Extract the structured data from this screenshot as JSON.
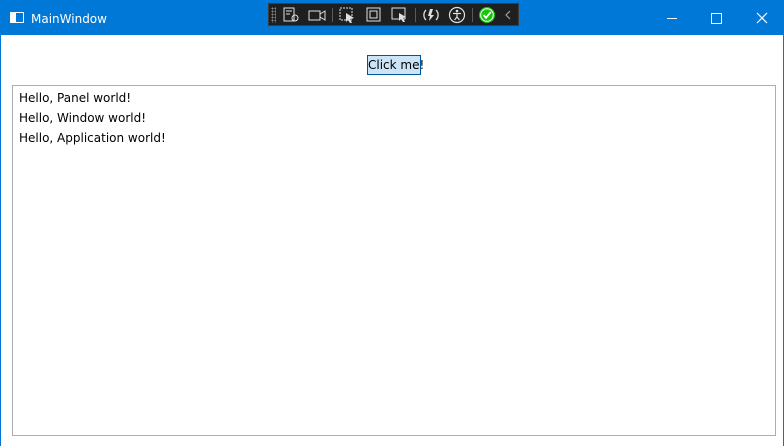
{
  "window": {
    "title": "MainWindow",
    "accent_color": "#0078d7",
    "caption_buttons": [
      "minimize-icon",
      "maximize-icon",
      "close-icon"
    ]
  },
  "debug_toolbar": {
    "icons": [
      "visual-tree-icon",
      "track-focus-icon",
      "select-element-icon",
      "display-layout-adorners-icon",
      "preview-selection-icon",
      "hot-reload-icon",
      "accessibility-icon",
      "binding-status-check-icon",
      "collapse-chevron-icon"
    ]
  },
  "content": {
    "button_label": "Click me!",
    "messages": [
      "Hello, Panel world!",
      "Hello, Window world!",
      "Hello, Application world!"
    ]
  }
}
